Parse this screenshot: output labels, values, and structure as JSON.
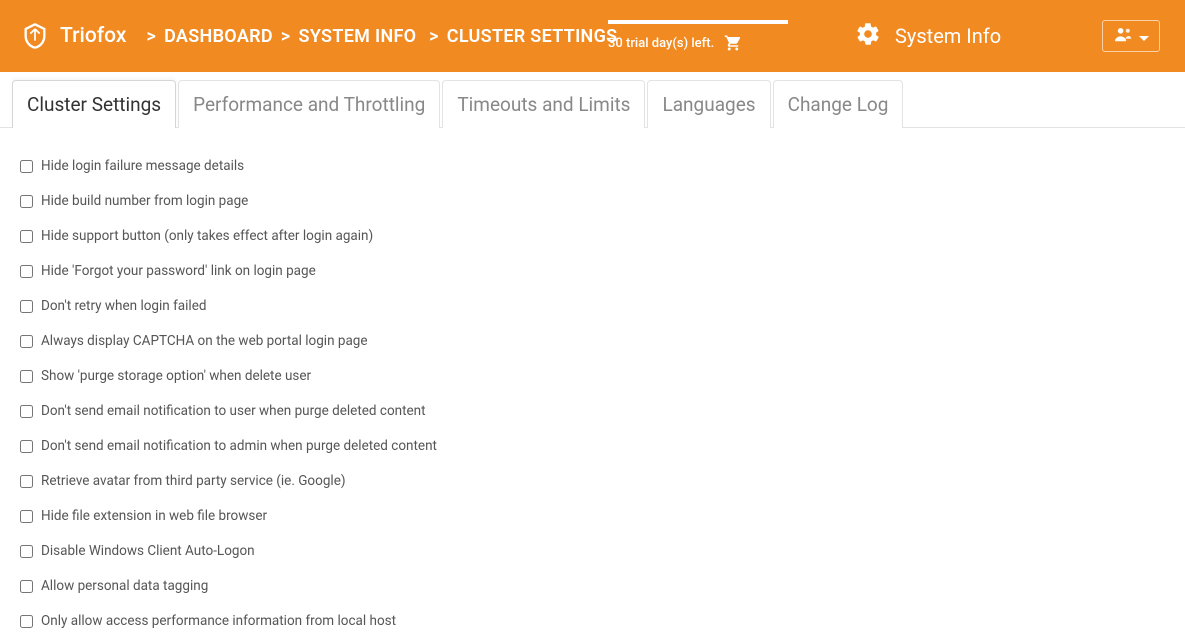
{
  "header": {
    "brand": "Triofox",
    "breadcrumb": [
      "DASHBOARD",
      "SYSTEM INFO",
      "CLUSTER SETTINGS"
    ],
    "trial_text": "30 trial day(s) left.",
    "sysinfo_label": "System Info"
  },
  "tabs": [
    {
      "label": "Cluster Settings",
      "active": true
    },
    {
      "label": "Performance and Throttling",
      "active": false
    },
    {
      "label": "Timeouts and Limits",
      "active": false
    },
    {
      "label": "Languages",
      "active": false
    },
    {
      "label": "Change Log",
      "active": false
    }
  ],
  "settings": [
    {
      "label": "Hide login failure message details",
      "checked": false
    },
    {
      "label": "Hide build number from login page",
      "checked": false
    },
    {
      "label": "Hide support button (only takes effect after login again)",
      "checked": false
    },
    {
      "label": "Hide 'Forgot your password' link on login page",
      "checked": false
    },
    {
      "label": "Don't retry when login failed",
      "checked": false
    },
    {
      "label": "Always display CAPTCHA on the web portal login page",
      "checked": false
    },
    {
      "label": "Show 'purge storage option' when delete user",
      "checked": false
    },
    {
      "label": "Don't send email notification to user when purge deleted content",
      "checked": false
    },
    {
      "label": "Don't send email notification to admin when purge deleted content",
      "checked": false
    },
    {
      "label": "Retrieve avatar from third party service (ie. Google)",
      "checked": false
    },
    {
      "label": "Hide file extension in web file browser",
      "checked": false
    },
    {
      "label": "Disable Windows Client Auto-Logon",
      "checked": false
    },
    {
      "label": "Allow personal data tagging",
      "checked": false
    },
    {
      "label": "Only allow access performance information from local host",
      "checked": false
    }
  ]
}
